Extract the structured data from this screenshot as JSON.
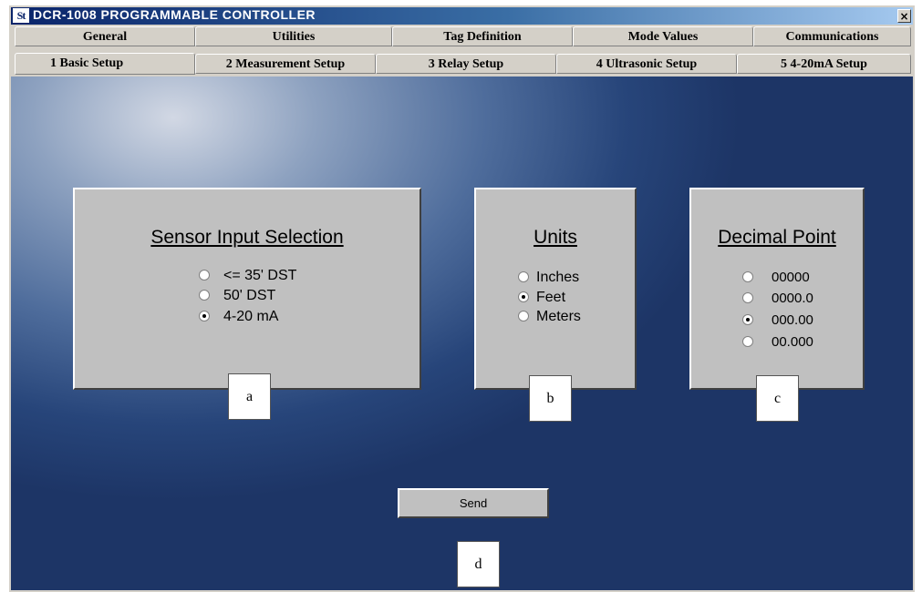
{
  "titlebar": {
    "logo": "St",
    "title": "DCR-1008 PROGRAMMABLE CONTROLLER",
    "close": "×"
  },
  "tabs_top": [
    "General",
    "Utilities",
    "Tag Definition",
    "Mode Values",
    "Communications"
  ],
  "tabs_bottom": [
    "1  Basic Setup",
    "2 Measurement Setup",
    "3 Relay Setup",
    "4 Ultrasonic Setup",
    "5 4-20mA Setup"
  ],
  "active_tab": "1  Basic Setup",
  "sensor": {
    "title": "Sensor Input Selection",
    "options": [
      "<= 35' DST",
      "50' DST",
      "4-20 mA"
    ],
    "selected": "4-20 mA"
  },
  "units": {
    "title": "Units",
    "options": [
      "Inches",
      "Feet",
      "Meters"
    ],
    "selected": "Feet"
  },
  "decimal": {
    "title": "Decimal Point",
    "options": [
      "00000",
      "0000.0",
      "000.00",
      "00.000"
    ],
    "selected": "000.00"
  },
  "send_label": "Send",
  "callouts": [
    "a",
    "b",
    "c",
    "d"
  ]
}
